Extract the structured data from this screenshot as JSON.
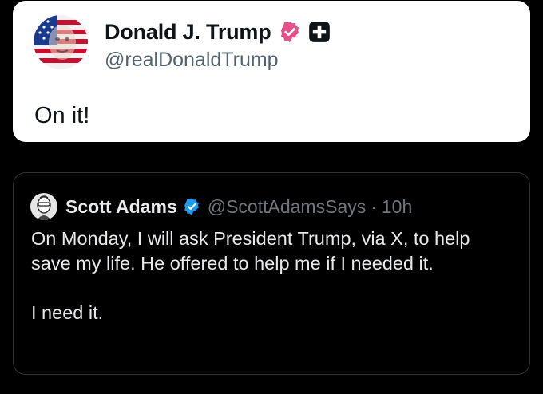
{
  "reply": {
    "author_name": "Donald J. Trump",
    "author_handle": "@realDonaldTrump",
    "text": "On it!",
    "verified_badge": "gold-verified-badge-icon",
    "affiliate_badge": "affiliate-plus-icon",
    "badge_color": "#e5508a"
  },
  "quote": {
    "author_name": "Scott Adams",
    "author_handle": "@ScottAdamsSays",
    "separator": "·",
    "time": "10h",
    "verified_badge": "blue-verified-badge-icon",
    "badge_color": "#1d9bf0",
    "paragraph_1": "On Monday, I will ask President Trump, via X, to help save my life. He offered to help me if I needed it.",
    "paragraph_2": "I need it."
  }
}
